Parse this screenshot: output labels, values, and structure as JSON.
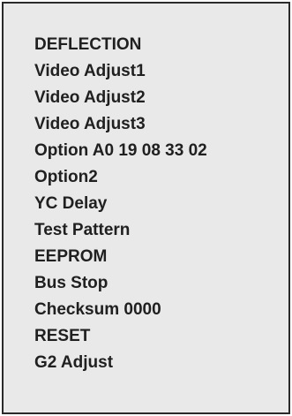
{
  "service_menu": {
    "items": [
      {
        "label": "DEFLECTION"
      },
      {
        "label": "Video Adjust1"
      },
      {
        "label": "Video Adjust2"
      },
      {
        "label": "Video Adjust3"
      },
      {
        "label": "Option A0 19 08 33 02"
      },
      {
        "label": "Option2"
      },
      {
        "label": "YC Delay"
      },
      {
        "label": "Test Pattern"
      },
      {
        "label": "EEPROM"
      },
      {
        "label": "Bus Stop"
      },
      {
        "label": "Checksum 0000"
      },
      {
        "label": "RESET"
      },
      {
        "label": "G2 Adjust"
      }
    ],
    "colors": {
      "panel_background": "#e9e9e9",
      "border": "#2a2a2a",
      "text": "#202020"
    }
  }
}
